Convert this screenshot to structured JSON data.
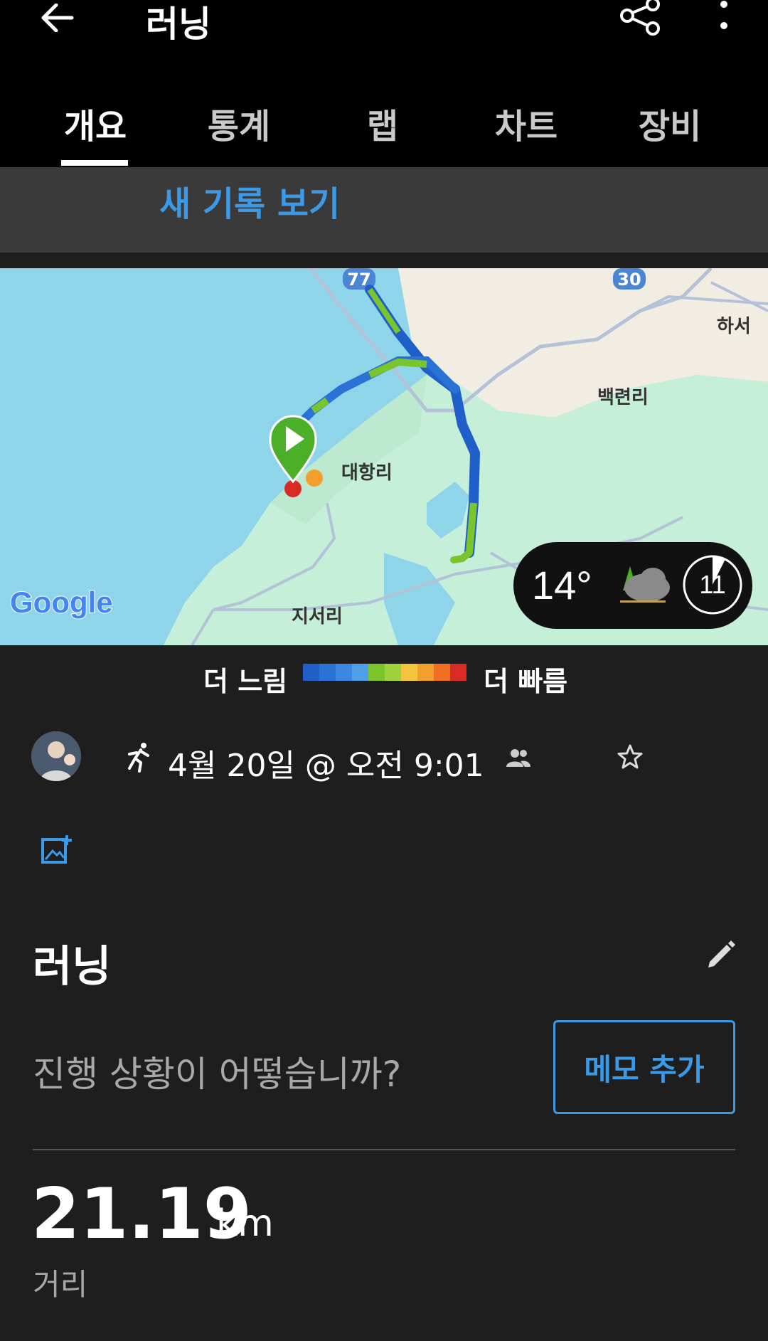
{
  "header": {
    "title": "러닝"
  },
  "tabs": [
    {
      "label": "개요"
    },
    {
      "label": "통계"
    },
    {
      "label": "랩"
    },
    {
      "label": "차트"
    },
    {
      "label": "장비"
    }
  ],
  "notice": {
    "link": "새 기록 보기"
  },
  "map": {
    "places": {
      "a": "하서",
      "b": "백련리",
      "c": "대항리",
      "d": "지서리"
    },
    "roads": [
      "77",
      "30"
    ],
    "attribution": "Google",
    "colors": {
      "water": "#8ed5ea",
      "land": "#c6efda",
      "beige": "#f1ede3"
    }
  },
  "weather": {
    "temp": "14°",
    "value": "11"
  },
  "legend": {
    "slow": "더 느림",
    "fast": "더 빠름",
    "colors": [
      "#1f5fc7",
      "#2a72d4",
      "#3b88e2",
      "#4fa0e8",
      "#7ac52c",
      "#9fd23a",
      "#f3c33c",
      "#f39f2d",
      "#ef6f25",
      "#d92b25"
    ]
  },
  "activity": {
    "date": "4월 20일 @ 오전 9:01",
    "title": "러닝",
    "prompt": "진행 상황이 어떻습니까?",
    "memo_button": "메모 추가",
    "distance": "21.19",
    "distance_unit": "km",
    "distance_label": "거리"
  }
}
